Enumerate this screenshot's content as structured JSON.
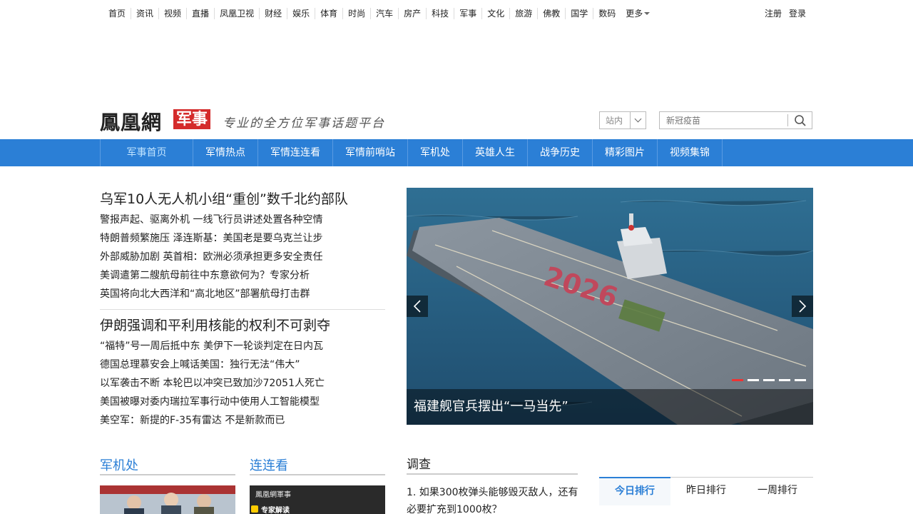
{
  "topnav": {
    "items": [
      "首页",
      "资讯",
      "视频",
      "直播",
      "凤凰卫视",
      "财经",
      "娱乐",
      "体育",
      "时尚",
      "汽车",
      "房产",
      "科技",
      "军事",
      "文化",
      "旅游",
      "佛教",
      "国学",
      "数码"
    ],
    "more": "更多",
    "register": "注册",
    "login": "登录"
  },
  "header": {
    "logo": "鳳凰網",
    "channel": "军事",
    "slogan": "专业的全方位军事话题平台",
    "site_select": "站内",
    "search_placeholder": "新冠疫苗"
  },
  "channel_nav": {
    "items": [
      "军事首页",
      "军情热点",
      "军情连连看",
      "军情前哨站",
      "军机处",
      "英雄人生",
      "战争历史",
      "精彩图片",
      "视频集锦"
    ]
  },
  "headlines": {
    "group1": {
      "title": "乌军10人无人机小组“重创”数千北约部队",
      "items": [
        "警报声起、驱离外机 一线飞行员讲述处置各种空情",
        "特朗普频繁施压 泽连斯基：美国老是要乌克兰让步",
        "外部威胁加剧 英首相：欧洲必须承担更多安全责任",
        "美调遣第二艘航母前往中东意欲何为？专家分析",
        "英国将向北大西洋和“高北地区”部署航母打击群"
      ]
    },
    "group2": {
      "title": "伊朗强调和平利用核能的权利不可剥夺",
      "items": [
        "“福特”号一周后抵中东 美伊下一轮谈判定在日内瓦",
        "德国总理慕安会上喊话美国：独行无法“伟大”",
        "以军袭击不断 本轮巴以冲突已致加沙72051人死亡",
        "美国被曝对委内瑞拉军事行动中使用人工智能模型",
        "美空军：新提的F-35有雷达 不是新款而已"
      ]
    }
  },
  "slider": {
    "caption": "福建舰官兵摆出“一马当先”",
    "deck_text": "2026",
    "slide_count": 5,
    "active_slide": 1
  },
  "sections": {
    "junjichu": "军机处",
    "lianliankan": "连连看",
    "thumb2_logo": "鳳凰網軍事",
    "thumb2_tag": "专家解读"
  },
  "survey": {
    "title": "调查",
    "question": "1. 如果300枚弹头能够毁灭敌人，还有必要扩充到1000枚？"
  },
  "ranking": {
    "tabs": [
      "今日排行",
      "昨日排行",
      "一周排行"
    ]
  },
  "colors": {
    "accent_blue": "#2b7fd6",
    "logo_red": "#d42b2b"
  }
}
